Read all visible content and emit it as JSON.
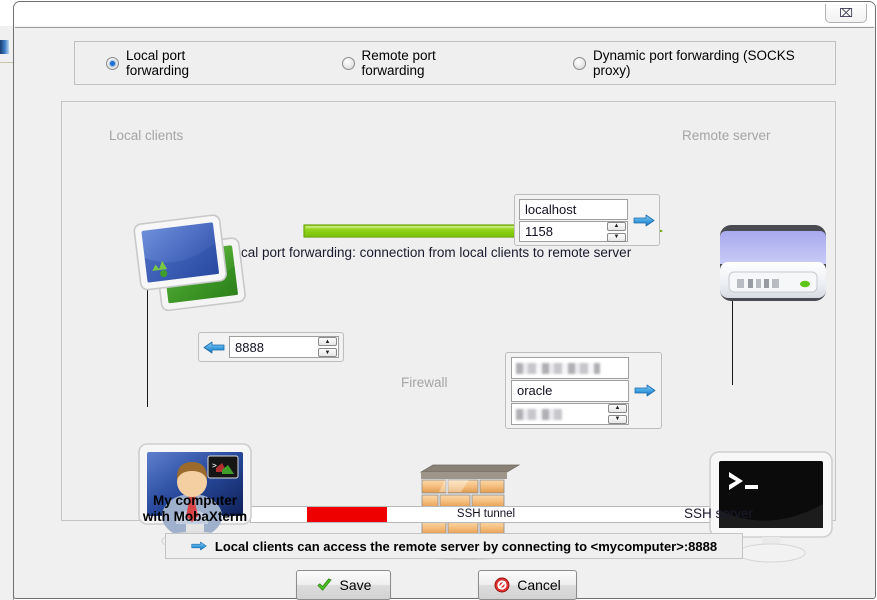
{
  "window": {
    "close_icon": "close-icon",
    "close_glyph": "⌧"
  },
  "modes": {
    "options": [
      {
        "id": "local",
        "label": "Local port forwarding",
        "selected": true
      },
      {
        "id": "remote",
        "label": "Remote port forwarding",
        "selected": false
      },
      {
        "id": "dynamic",
        "label": "Dynamic port forwarding (SOCKS proxy)",
        "selected": false
      }
    ]
  },
  "diagram": {
    "local_clients_label": "Local clients",
    "remote_server_label": "Remote server",
    "firewall_label": "Firewall",
    "tunnel_label": "SSH tunnel",
    "arrow_caption": "Local port forwarding: connection from local clients to remote server",
    "my_computer_line1": "My computer",
    "my_computer_line2": "with MobaXterm",
    "ssh_server_label": "SSH server",
    "arrow_color": "#8fd411",
    "tunnel_highlight_color": "#ee0000"
  },
  "forward_port": {
    "value": "8888",
    "arrow_icon": "arrow-left-icon",
    "spin_up": "▲",
    "spin_down": "▼"
  },
  "remote_target": {
    "host": "localhost",
    "port": "1158",
    "arrow_icon": "arrow-right-icon",
    "spin_up": "▲",
    "spin_down": "▼"
  },
  "ssh_server_fields": {
    "host_redacted": "",
    "user": "oracle",
    "port_redacted": "",
    "arrow_icon": "arrow-right-icon",
    "spin_up": "▲",
    "spin_down": "▼"
  },
  "info": {
    "icon": "arrow-right-icon",
    "text": "Local clients can access the remote server by connecting to <mycomputer>:8888"
  },
  "buttons": {
    "save": "Save",
    "cancel": "Cancel"
  }
}
